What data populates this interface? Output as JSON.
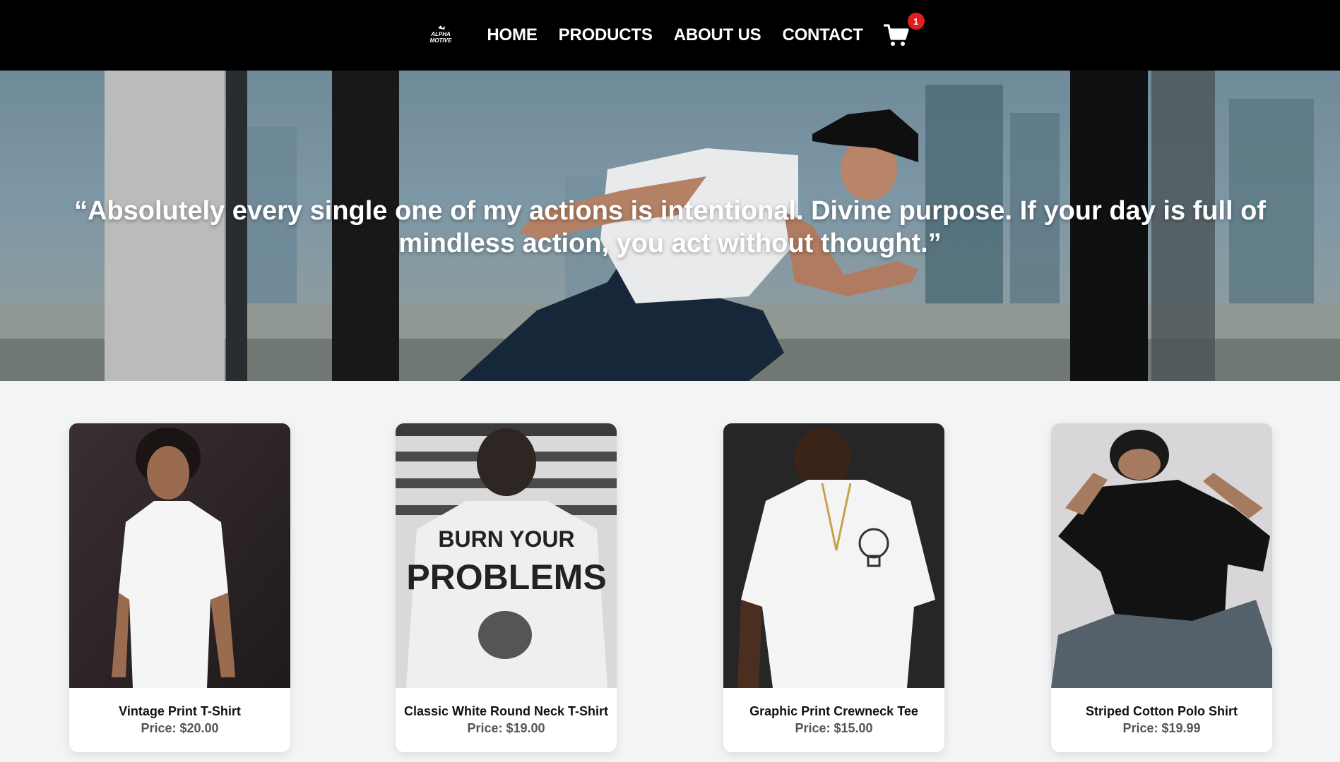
{
  "nav": {
    "logo_text": "ALPHA MOTIVE",
    "links": [
      {
        "label": "HOME"
      },
      {
        "label": "PRODUCTS"
      },
      {
        "label": "ABOUT US"
      },
      {
        "label": "CONTACT"
      }
    ],
    "cart_icon": "shopping-cart-icon",
    "cart_count": "1"
  },
  "hero": {
    "quote": "“Absolutely every single one of my actions is intentional. Divine purpose. If your day is full of mindless action, you act without thought.”"
  },
  "products": [
    {
      "name": "Vintage Print T-Shirt",
      "price": "Price: $20.00"
    },
    {
      "name": "Classic White Round Neck T-Shirt",
      "price": "Price: $19.00"
    },
    {
      "name": "Graphic Print Crewneck Tee",
      "price": "Price: $15.00"
    },
    {
      "name": "Striped Cotton Polo Shirt",
      "price": "Price: $19.99"
    }
  ],
  "colors": {
    "nav_bg": "#000000",
    "page_bg": "#f3f4f6",
    "badge": "#e11d1d"
  }
}
